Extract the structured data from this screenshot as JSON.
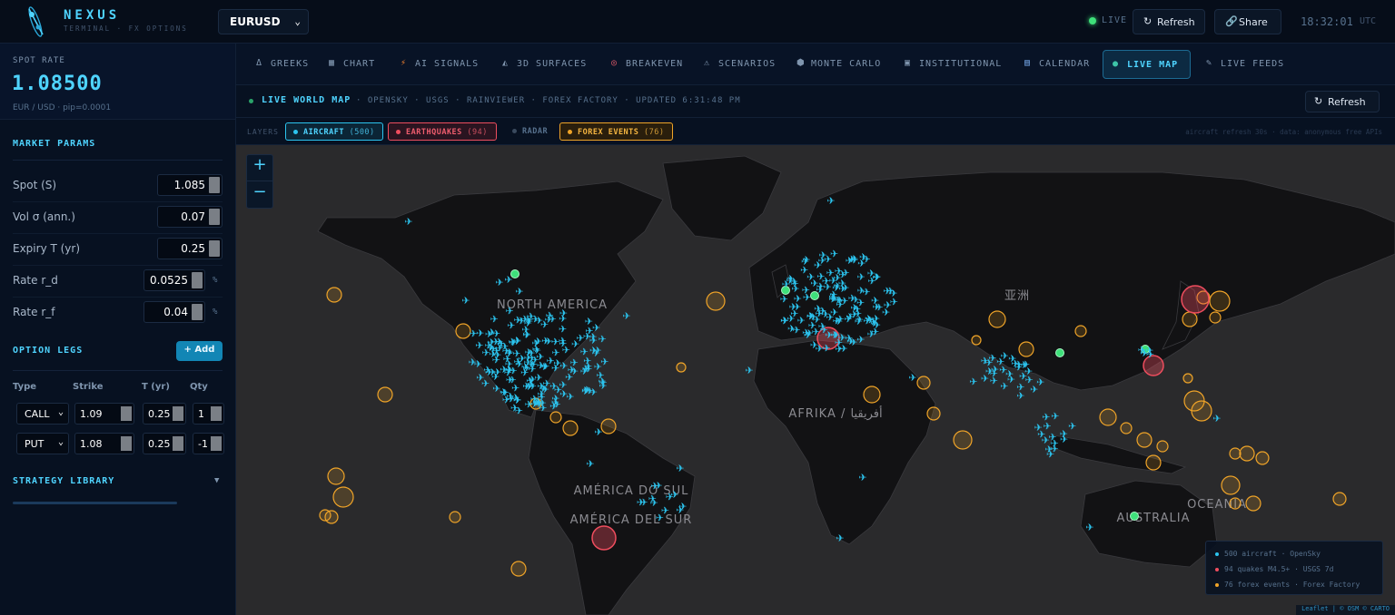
{
  "header": {
    "brand": "NEXUS",
    "brand_sub": "TERMINAL · FX OPTIONS",
    "pair": "EURUSD",
    "live_label": "LIVE",
    "refresh_label": "Refresh",
    "share_label": "Share",
    "clock": "18:32:01",
    "timezone": "UTC",
    "icons": [
      "nexus-logo-icon",
      "chevron-down-icon",
      "refresh-icon",
      "link-icon"
    ]
  },
  "sidebar": {
    "spot_label": "SPOT RATE",
    "spot_value": "1.08500",
    "spot_sub": "EUR / USD · pip=0.0001",
    "market_params_title": "MARKET PARAMS",
    "params": [
      {
        "label": "Spot (S)",
        "value": "1.085",
        "unit": ""
      },
      {
        "label": "Vol σ (ann.)",
        "value": "0.07",
        "unit": ""
      },
      {
        "label": "Expiry T (yr)",
        "value": "0.25",
        "unit": ""
      },
      {
        "label": "Rate r_d",
        "value": "0.0525",
        "unit": "%"
      },
      {
        "label": "Rate r_f",
        "value": "0.04",
        "unit": "%"
      }
    ],
    "option_legs_title": "OPTION LEGS",
    "add_label": "+ Add",
    "legs_headers": [
      "Type",
      "Strike",
      "T (yr)",
      "Qty"
    ],
    "legs": [
      {
        "type": "CALL",
        "strike": "1.09",
        "t": "0.25",
        "qty": "1"
      },
      {
        "type": "PUT",
        "strike": "1.08",
        "t": "0.25",
        "qty": "-1"
      }
    ],
    "strategy_library_title": "STRATEGY LIBRARY"
  },
  "tabs": [
    {
      "icon": "Δ",
      "label": "GREEKS",
      "active": false
    },
    {
      "icon": "▦",
      "label": "CHART",
      "active": false
    },
    {
      "icon": "⚡",
      "label": "AI SIGNALS",
      "active": false
    },
    {
      "icon": "◭",
      "label": "3D SURFACES",
      "active": false
    },
    {
      "icon": "◎",
      "label": "BREAKEVEN",
      "active": false
    },
    {
      "icon": "⚠",
      "label": "SCENARIOS",
      "active": false
    },
    {
      "icon": "⬢",
      "label": "MONTE CARLO",
      "active": false
    },
    {
      "icon": "▣",
      "label": "INSTITUTIONAL",
      "active": false
    },
    {
      "icon": "▤",
      "label": "CALENDAR",
      "active": false
    },
    {
      "icon": "●",
      "label": "LIVE MAP",
      "active": true
    },
    {
      "icon": "✎",
      "label": "LIVE FEEDS",
      "active": false
    }
  ],
  "map_header": {
    "title": "LIVE WORLD MAP",
    "sources": "· OPENSKY · USGS · RAINVIEWER · FOREX FACTORY · UPDATED 6:31:48 PM",
    "refresh_label": "Refresh"
  },
  "layers": {
    "label": "LAYERS",
    "chips": [
      {
        "label": "AIRCRAFT",
        "count": "(500)",
        "color": "#2cc4ef",
        "active": true
      },
      {
        "label": "EARTHQUAKES",
        "count": "(94)",
        "color": "#ef4d5e",
        "active": true
      },
      {
        "label": "RADAR",
        "count": "",
        "color": "#57718d",
        "active": false
      },
      {
        "label": "FOREX EVENTS",
        "count": "(76)",
        "color": "#f0a428",
        "active": true
      }
    ],
    "note": "aircraft refresh 30s · data: anonymous free APIs"
  },
  "map": {
    "zoom_in": "+",
    "zoom_out": "−",
    "labels": [
      {
        "text": "NORTH AMERICA",
        "cls": "na"
      },
      {
        "text": "AFRIKA / أفريقيا",
        "cls": "af"
      },
      {
        "text": "亚洲",
        "cls": "as"
      },
      {
        "text": "AMÉRICA DO SUL / AMÉRICA DEL SUR",
        "cls": "sa"
      },
      {
        "text": "AUSTRALIA",
        "cls": "au"
      },
      {
        "text": "OCEANIA",
        "cls": "oc"
      }
    ],
    "legend": [
      {
        "text": "500 aircraft · OpenSky",
        "color": "#2cc4ef"
      },
      {
        "text": "94 quakes M4.5+ · USGS 7d",
        "color": "#ef4d5e"
      },
      {
        "text": "76 forex events · Forex Factory",
        "color": "#f0a428"
      }
    ],
    "attribution": "Leaflet | © OSM © CARTO",
    "colors": {
      "aircraft": "#2cc4ef",
      "quake": "#ef4d5e",
      "forex": "#f0a428",
      "green": "#3ee07a"
    }
  }
}
